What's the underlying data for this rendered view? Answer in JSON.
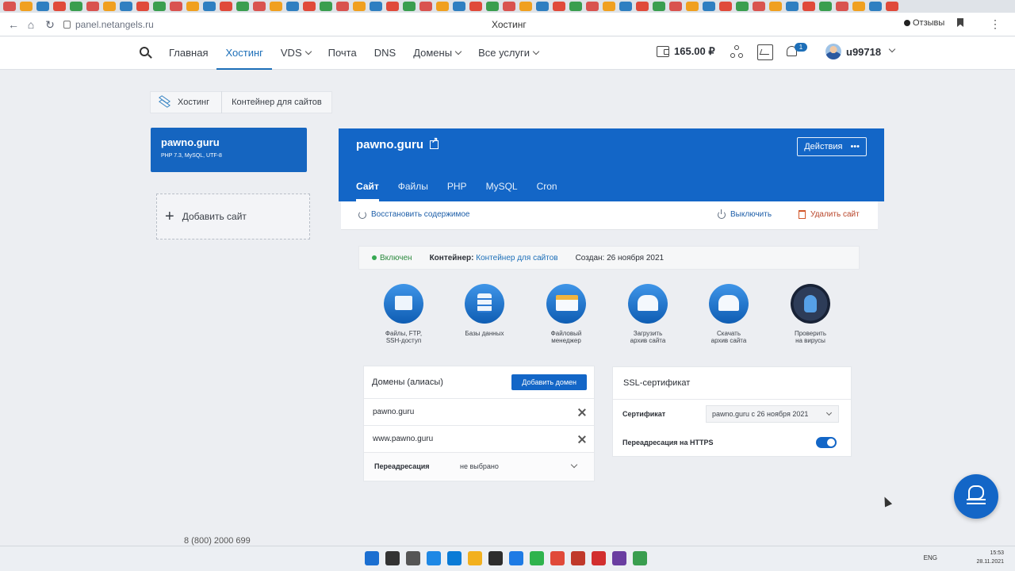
{
  "browser": {
    "url": "panel.netangels.ru",
    "tab_title": "Хостинг",
    "reviews_label": "Отзывы",
    "tab_favicons": [
      "#d9534f",
      "#f0a020",
      "#2f7fc1",
      "#e04a3a",
      "#3a9e4f",
      "#d9534f",
      "#f0a020",
      "#2f7fc1",
      "#e04a3a",
      "#3a9e4f",
      "#d9534f",
      "#f0a020",
      "#2f7fc1",
      "#e04a3a",
      "#3a9e4f",
      "#d9534f",
      "#f0a020",
      "#2f7fc1",
      "#e04a3a",
      "#3a9e4f",
      "#d9534f",
      "#f0a020",
      "#2f7fc1",
      "#e04a3a",
      "#3a9e4f",
      "#d9534f",
      "#f0a020",
      "#2f7fc1",
      "#e04a3a",
      "#3a9e4f",
      "#d9534f",
      "#f0a020",
      "#2f7fc1",
      "#e04a3a",
      "#3a9e4f",
      "#d9534f",
      "#f0a020",
      "#2f7fc1",
      "#e04a3a",
      "#3a9e4f",
      "#d9534f",
      "#f0a020",
      "#2f7fc1",
      "#e04a3a",
      "#3a9e4f",
      "#d9534f",
      "#f0a020",
      "#2f7fc1",
      "#e04a3a",
      "#3a9e4f",
      "#d9534f",
      "#f0a020",
      "#2f7fc1",
      "#e04a3a"
    ]
  },
  "nav": {
    "items": [
      {
        "label": "Главная"
      },
      {
        "label": "Хостинг"
      },
      {
        "label": "VDS"
      },
      {
        "label": "Почта"
      },
      {
        "label": "DNS"
      },
      {
        "label": "Домены"
      },
      {
        "label": "Все услуги"
      }
    ],
    "balance": "165.00 ₽",
    "notifications_count": "1",
    "username": "u99718"
  },
  "breadcrumb": {
    "root": "Хостинг",
    "current": "Контейнер для сайтов"
  },
  "site_card": {
    "name": "pawno.guru",
    "specs": "PHP 7.3, MySQL, UTF-8"
  },
  "add_site_label": "Добавить сайт",
  "main": {
    "title": "pawno.guru",
    "actions_label": "Действия",
    "tabs": [
      "Сайт",
      "Файлы",
      "PHP",
      "MySQL",
      "Cron"
    ],
    "toolbar": {
      "restore": "Восстановить содержимое",
      "disable": "Выключить",
      "delete": "Удалить сайт"
    },
    "status": {
      "state": "Включен",
      "container_label": "Контейнер:",
      "container_value": "Контейнер для сайтов",
      "created": "Создан: 26 ноября 2021"
    },
    "quick_actions": [
      {
        "l1": "Файлы, FTP,",
        "l2": "SSH-доступ"
      },
      {
        "l1": "Базы данных",
        "l2": ""
      },
      {
        "l1": "Файловый",
        "l2": "менеджер"
      },
      {
        "l1": "Загрузить",
        "l2": "архив сайта"
      },
      {
        "l1": "Скачать",
        "l2": "архив сайта"
      },
      {
        "l1": "Проверить",
        "l2": "на вирусы"
      }
    ]
  },
  "domains": {
    "title": "Домены (алиасы)",
    "add_button": "Добавить домен",
    "list": [
      "pawno.guru",
      "www.pawno.guru"
    ],
    "redirect_label": "Переадресация",
    "redirect_value": "не выбрано"
  },
  "ssl": {
    "title": "SSL-сертификат",
    "cert_label": "Сертификат",
    "cert_value": "pawno.guru с 26 ноября 2021",
    "https_label": "Переадресация на HTTPS",
    "https_enabled": true
  },
  "footer": {
    "phone": "8 (800) 2000 699"
  },
  "taskbar": {
    "lang": "ENG",
    "time": "15:53",
    "date": "28.11.2021",
    "app_colors": [
      "#1b6fd1",
      "#333333",
      "#555555",
      "#1e88e5",
      "#0a7bd6",
      "#f2b01e",
      "#2d2d2d",
      "#1e7be5",
      "#2fb34d",
      "#e04a3a",
      "#c0392b",
      "#d22f2f",
      "#6a3ea1",
      "#3a9e4f"
    ]
  }
}
